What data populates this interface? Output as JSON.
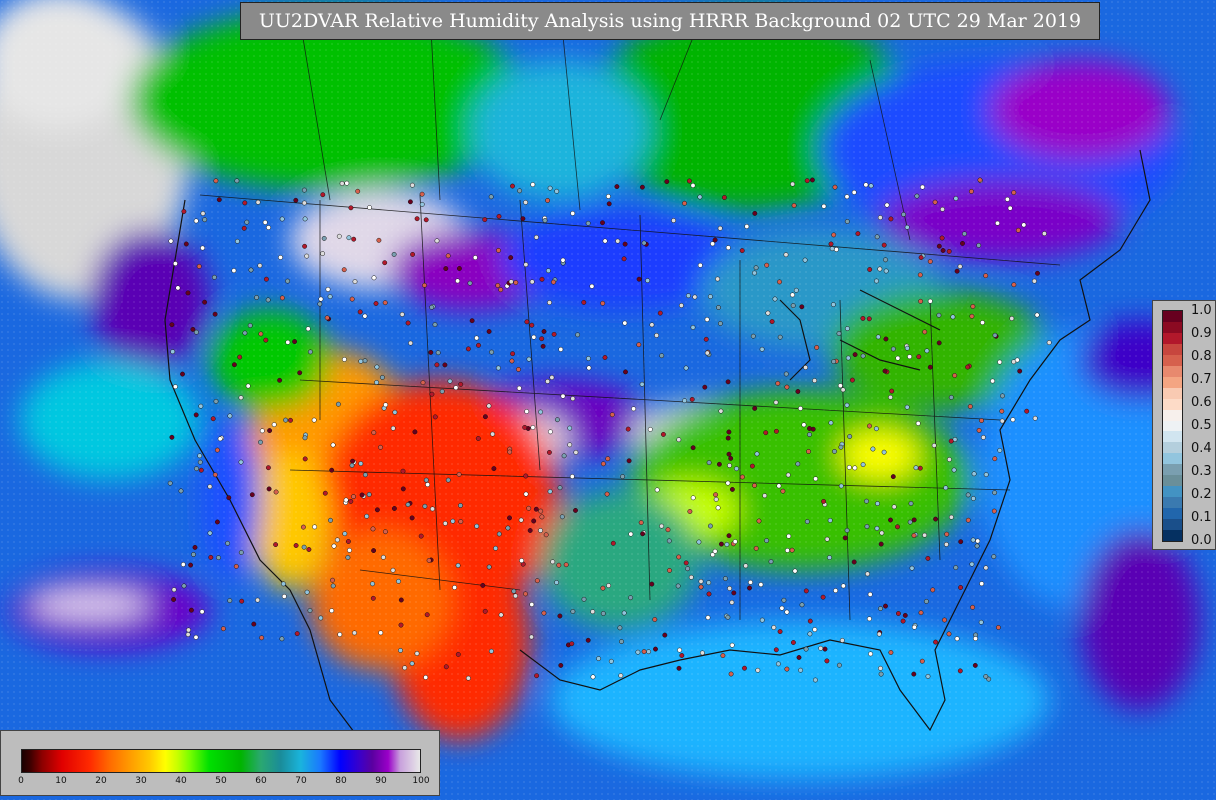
{
  "map": {
    "title": "UU2DVAR Relative Humidity Analysis using HRRR Background 02 UTC 29 Mar 2019",
    "background_color": "#c8c8c8",
    "ocean_color": "#1e6ee6",
    "field": "Relative Humidity"
  },
  "obs_legend": {
    "labels": [
      "1.0",
      "0.9",
      "0.8",
      "0.7",
      "0.6",
      "0.5",
      "0.4",
      "0.3",
      "0.2",
      "0.1",
      "0.0"
    ],
    "colors": [
      "#67001f",
      "#8b0a22",
      "#b2182b",
      "#c7463e",
      "#d6604d",
      "#e8896e",
      "#f4a582",
      "#f9cab2",
      "#fddbc7",
      "#f7f0ec",
      "#eef2f4",
      "#d1e5f0",
      "#b4cfdd",
      "#92c5de",
      "#7a9fb0",
      "#6a8f99",
      "#4393c3",
      "#3a7ab0",
      "#2166ac",
      "#1a4f8a",
      "#053061"
    ]
  },
  "rh_legend": {
    "ticks": [
      "0",
      "10",
      "20",
      "30",
      "40",
      "50",
      "60",
      "70",
      "80",
      "90",
      "100"
    ]
  }
}
